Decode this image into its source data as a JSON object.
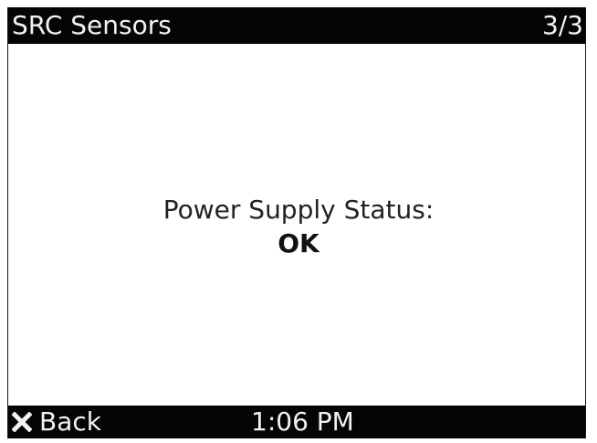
{
  "header": {
    "title": "SRC Sensors",
    "page_indicator": "3/3"
  },
  "main": {
    "status_label": "Power Supply Status:",
    "status_value": "OK"
  },
  "footer": {
    "back_icon": "close-x-icon",
    "back_label": "Back",
    "time": "1:06 PM"
  },
  "colors": {
    "bar_background": "#050505",
    "bar_text": "#f2f2f2",
    "screen_background": "#ffffff"
  }
}
